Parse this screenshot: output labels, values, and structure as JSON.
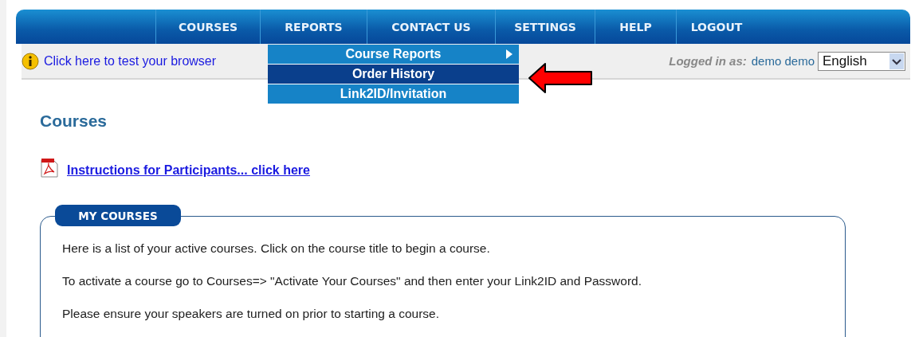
{
  "nav": {
    "items": [
      {
        "label": "COURSES"
      },
      {
        "label": "REPORTS"
      },
      {
        "label": "CONTACT US"
      },
      {
        "label": "SETTINGS"
      },
      {
        "label": "HELP"
      },
      {
        "label": "LOGOUT"
      }
    ]
  },
  "dropdown": {
    "items": [
      {
        "label": "Course Reports",
        "selected": false,
        "has_submenu": true
      },
      {
        "label": "Order History",
        "selected": true,
        "has_submenu": false
      },
      {
        "label": "Link2ID/Invitation",
        "selected": false,
        "has_submenu": false
      }
    ]
  },
  "info_bar": {
    "browser_link": "Click here to test your browser",
    "logged_in_label": "Logged in as:",
    "user": "demo demo",
    "language": "English"
  },
  "heading": "Courses",
  "instructions_link": "Instructions for Participants... click here",
  "my_courses": {
    "title": "MY COURSES",
    "paragraphs": [
      "Here is a list of your active courses. Click on the course title to begin a course.",
      "To activate a course go to Courses=> \"Activate Your Courses\" and then enter your Link2ID and Password.",
      "Please ensure your speakers are turned on prior to starting a course."
    ]
  }
}
